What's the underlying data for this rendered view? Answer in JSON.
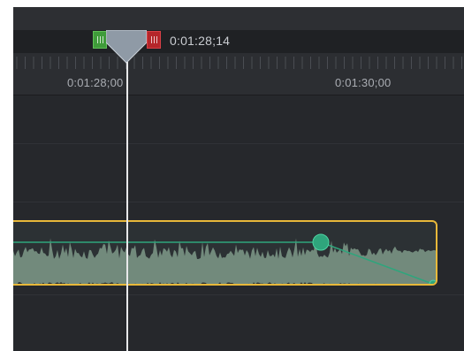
{
  "playhead": {
    "timecode": "0:01:28;14"
  },
  "ruler": {
    "labels": [
      "0:01:28;00",
      "0:01:30;00"
    ]
  },
  "colors": {
    "clip_border": "#e8b83a",
    "waveform": "#7f9a8a",
    "volume_line": "#2fa57c",
    "keyframe": "#2fa57c",
    "in_handle": "#3f9b3a",
    "out_handle": "#b5262a",
    "playhead": "#e8e9eb"
  },
  "icons": {
    "in_handle": "grip-lines-icon",
    "out_handle": "grip-lines-icon",
    "playhead": "playhead-marker-icon",
    "keyframe": "circle-keyframe-icon"
  }
}
